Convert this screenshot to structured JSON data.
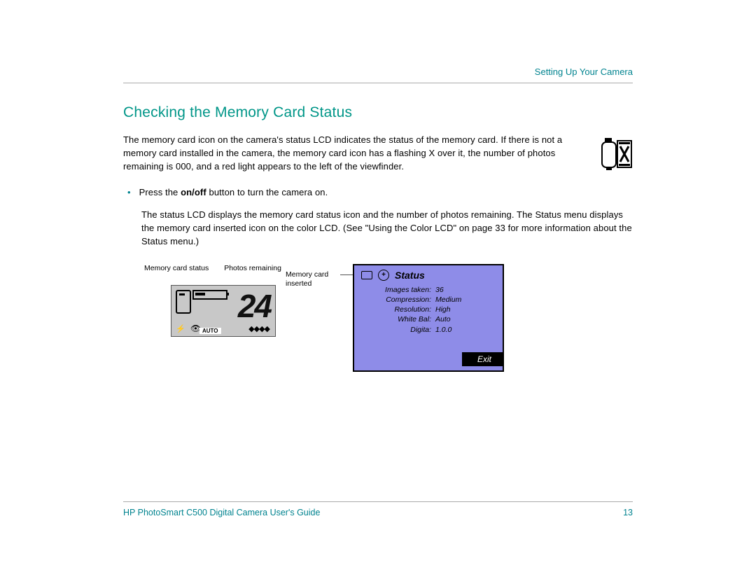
{
  "header": {
    "section_title": "Setting Up Your Camera"
  },
  "title": "Checking the Memory Card Status",
  "intro": "The memory card icon on the camera's status LCD indicates the status of the memory card. If there is not a memory card installed in the camera, the memory card icon has a flashing X over it, the number of photos remaining is 000, and a red light appears to the left of the viewfinder.",
  "bullet": {
    "prefix": "Press the ",
    "bold": "on/off",
    "suffix": " button to turn the camera on."
  },
  "sub_para": "The status LCD displays the memory card status icon and the number of photos remaining. The Status menu displays the memory card inserted icon on the color LCD. (See \"Using the Color LCD\" on page 33 for more information about the Status menu.)",
  "lcd": {
    "label_card": "Memory card status",
    "label_photos": "Photos remaining",
    "number": "24",
    "auto": "AUTO",
    "diamonds": "◆◆◆◆"
  },
  "color_lcd": {
    "label": "Memory card inserted",
    "status": "Status",
    "rows": [
      {
        "k": "Images taken:",
        "v": "36"
      },
      {
        "k": "Compression:",
        "v": "Medium"
      },
      {
        "k": "Resolution:",
        "v": "High"
      },
      {
        "k": "White Bal:",
        "v": "Auto"
      },
      {
        "k": "Digita:",
        "v": "1.0.0"
      }
    ],
    "exit": "Exit"
  },
  "footer": {
    "guide": "HP PhotoSmart C500 Digital Camera User's Guide",
    "page": "13"
  }
}
